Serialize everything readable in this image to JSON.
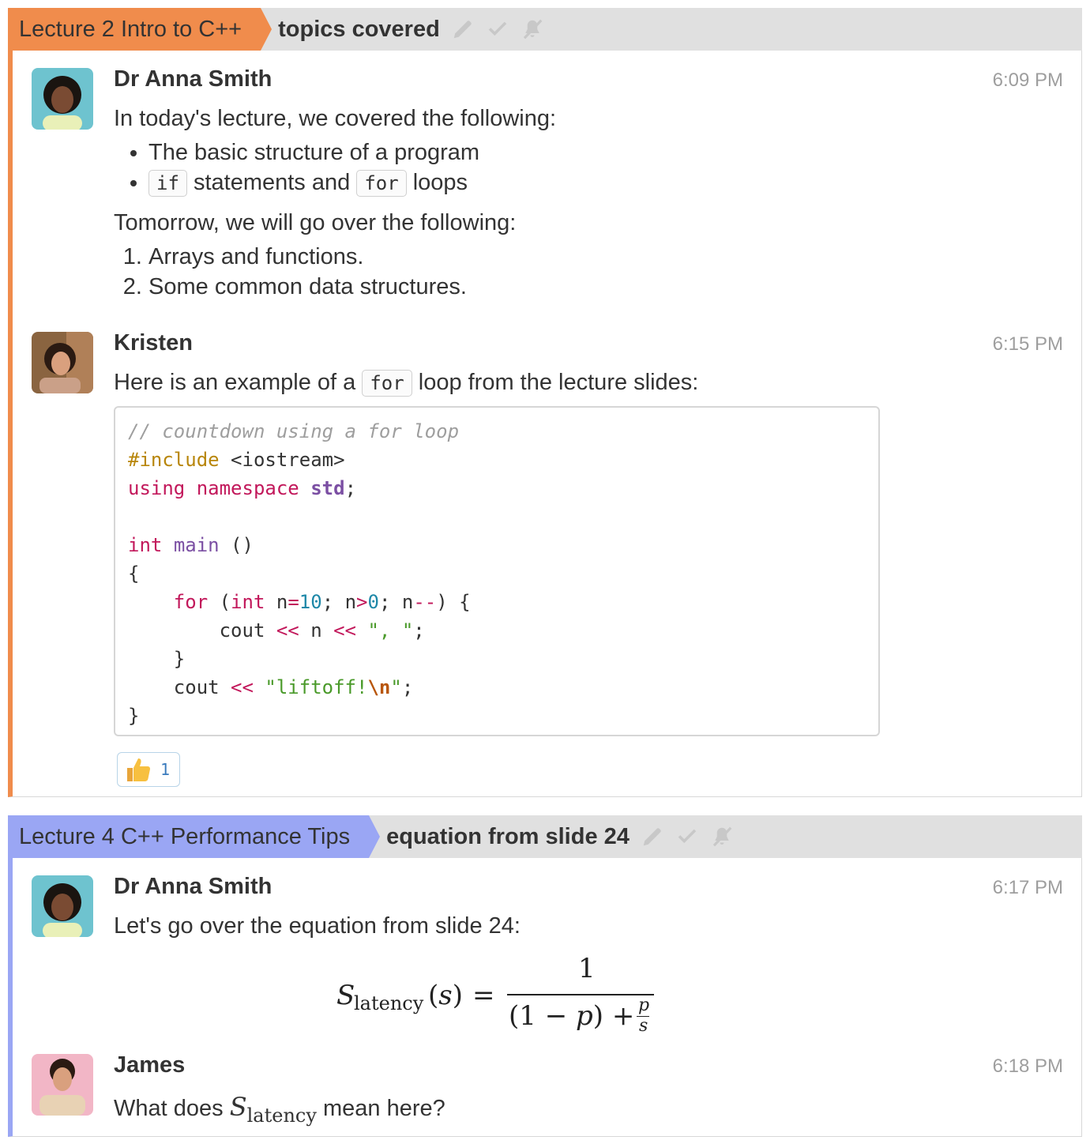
{
  "colors": {
    "stream1": "#f08c4c",
    "stream2": "#9aa6f4"
  },
  "threads": [
    {
      "stream": "Lecture 2 Intro to C++",
      "topic": "topics covered",
      "messages": [
        {
          "sender": "Dr Anna Smith",
          "time": "6:09 PM",
          "intro": "In today's lecture, we covered the following:",
          "bullets": [
            "The basic structure of a program"
          ],
          "bullet2": {
            "code1": "if",
            "mid": " statements and ",
            "code2": "for",
            "end": " loops"
          },
          "tomorrow": "Tomorrow, we will go over the following:",
          "numbered": [
            "Arrays and functions.",
            "Some common data structures."
          ]
        },
        {
          "sender": "Kristen",
          "time": "6:15 PM",
          "text_before": "Here is an example of a ",
          "text_code": "for",
          "text_after": " loop from the lecture slides:",
          "code": {
            "comment": "// countdown using a for loop",
            "include": "#include",
            "header": " <iostream>",
            "using": "using",
            "namespace": "namespace",
            "std": "std",
            "int": "int",
            "main": "main",
            "for": "for",
            "ten": "10",
            "zero": "0",
            "sep": "\", \"",
            "liftoff": "\"liftoff!",
            "esc": "\\n",
            "quote_end": "\""
          },
          "reaction": {
            "emoji": "thumbs-up",
            "count": "1"
          }
        }
      ]
    },
    {
      "stream": "Lecture 4 C++ Performance Tips",
      "topic": "equation from slide 24",
      "messages": [
        {
          "sender": "Dr Anna Smith",
          "time": "6:17 PM",
          "text": "Let's go over the equation from slide 24:",
          "equation": "S_latency(s) = 1 / ((1 − p) + p/s)"
        },
        {
          "sender": "James",
          "time": "6:18 PM",
          "text_before": "What does ",
          "math": "S_latency",
          "text_after": " mean here?"
        }
      ]
    }
  ],
  "icons": [
    "edit-icon",
    "check-icon",
    "mute-icon"
  ]
}
